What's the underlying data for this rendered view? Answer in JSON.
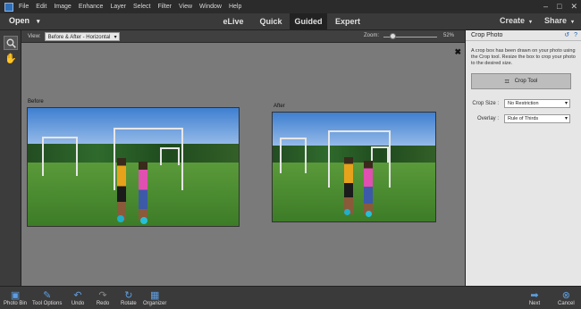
{
  "menu": [
    "File",
    "Edit",
    "Image",
    "Enhance",
    "Layer",
    "Select",
    "Filter",
    "View",
    "Window",
    "Help"
  ],
  "modebar": {
    "open": "Open",
    "tabs": [
      "eLive",
      "Quick",
      "Guided",
      "Expert"
    ],
    "active_tab": "Guided",
    "create": "Create",
    "share": "Share"
  },
  "options": {
    "view_label": "View:",
    "view_value": "Before & After - Horizontal",
    "zoom_label": "Zoom:",
    "zoom_value": "52%",
    "zoom_fraction": 0.52
  },
  "canvas": {
    "before_label": "Before",
    "after_label": "After"
  },
  "panel": {
    "title": "Crop Photo",
    "description": "A crop box has been drawn on your photo using the Crop tool. Resize the box to crop your photo to the desired size.",
    "crop_tool_label": "Crop Tool",
    "crop_size_label": "Crop Size :",
    "crop_size_value": "No Restriction",
    "overlay_label": "Overlay :",
    "overlay_value": "Rule of Thirds"
  },
  "bottom": {
    "photo_bin": "Photo Bin",
    "tool_options": "Tool Options",
    "undo": "Undo",
    "redo": "Redo",
    "rotate": "Rotate",
    "organizer": "Organizer",
    "next": "Next",
    "cancel": "Cancel"
  },
  "colors": {
    "accent": "#5d9ee3",
    "active_tab_bg": "#222222",
    "canvas_bg": "#7a7a7a",
    "panel_bg": "#e6e6e6"
  }
}
